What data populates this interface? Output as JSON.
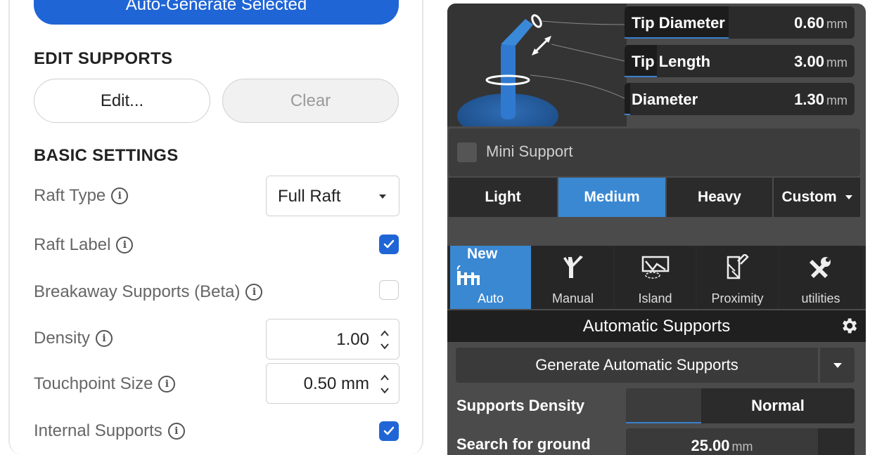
{
  "left_panel": {
    "auto_generate_label": "Auto-Generate Selected",
    "edit_supports_title": "EDIT SUPPORTS",
    "edit_button": "Edit...",
    "clear_button": "Clear",
    "basic_settings_title": "BASIC SETTINGS",
    "raft_type": {
      "label": "Raft Type",
      "value": "Full Raft"
    },
    "raft_label": {
      "label": "Raft Label",
      "checked": true
    },
    "breakaway": {
      "label": "Breakaway Supports (Beta)",
      "checked": false
    },
    "density": {
      "label": "Density",
      "value": "1.00"
    },
    "touchpoint": {
      "label": "Touchpoint Size",
      "value": "0.50 mm"
    },
    "internal": {
      "label": "Internal Supports",
      "checked": true
    },
    "info_glyph": "i",
    "accent_color": "#1f65d6"
  },
  "right_panel": {
    "params": [
      {
        "name": "Tip Diameter",
        "value": "0.60",
        "unit": "mm"
      },
      {
        "name": "Tip Length",
        "value": "3.00",
        "unit": "mm"
      },
      {
        "name": "Diameter",
        "value": "1.30",
        "unit": "mm"
      }
    ],
    "mini_support_label": "Mini Support",
    "presets": [
      "Light",
      "Medium",
      "Heavy",
      "Custom"
    ],
    "active_preset": "Medium",
    "tabs": [
      {
        "label": "Auto",
        "icon": "auto-support-icon"
      },
      {
        "label": "Manual",
        "icon": "manual-support-icon"
      },
      {
        "label": "Island",
        "icon": "island-icon"
      },
      {
        "label": "Proximity",
        "icon": "proximity-icon"
      },
      {
        "label": "utilities",
        "icon": "tools-icon"
      }
    ],
    "new_badge": "New",
    "section_title": "Automatic Supports",
    "generate_button": "Generate Automatic Supports",
    "supports_density": {
      "label": "Supports Density",
      "value": "Normal"
    },
    "search_ground": {
      "label": "Search for ground",
      "value": "25.00",
      "unit": "mm"
    },
    "accent_color": "#3a88d2"
  }
}
